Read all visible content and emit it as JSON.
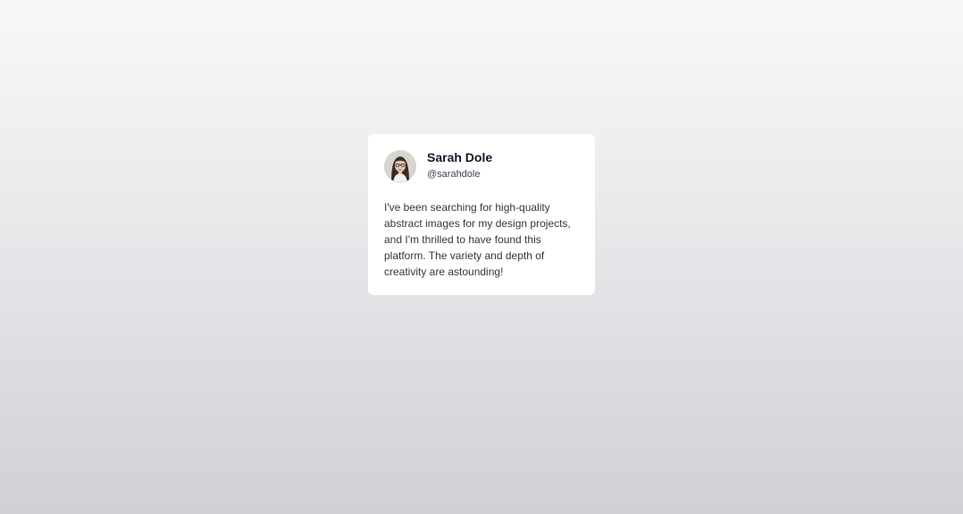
{
  "testimonial": {
    "name": "Sarah Dole",
    "handle": "@sarahdole",
    "quote": "I've been searching for high-quality abstract images for my design projects, and I'm thrilled to have found this platform. The variety and depth of creativity are astounding!"
  }
}
